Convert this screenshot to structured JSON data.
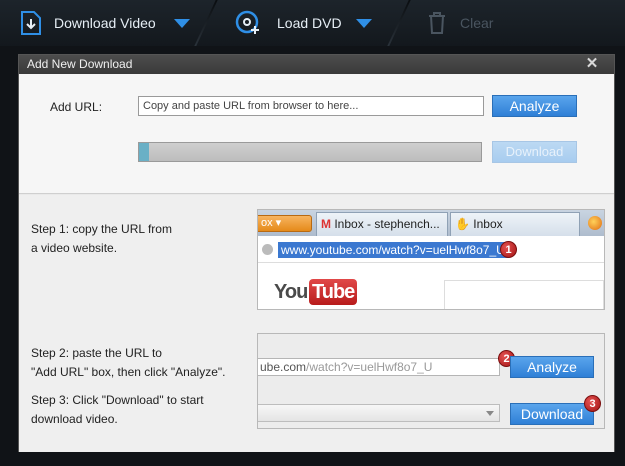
{
  "toolbar": {
    "download_video": "Download Video",
    "load_dvd": "Load DVD",
    "clear": "Clear"
  },
  "dialog": {
    "title": "Add New Download",
    "add_url_label": "Add URL:",
    "url_placeholder": "Copy and paste URL from browser to here...",
    "analyze_button": "Analyze",
    "download_button": "Download",
    "progress": 0.01
  },
  "steps": {
    "step1": [
      "Step 1: copy the URL from",
      "a video website."
    ],
    "step2": [
      "Step 2: paste the URL to",
      "\"Add URL\" box, then click \"Analyze\"."
    ],
    "step3": [
      "Step 3: Click \"Download\" to start",
      "download video."
    ]
  },
  "illustration": {
    "orange_tab": "ox",
    "tab_inbox_1": "Inbox - stephench...",
    "tab_inbox_2": "Inbox",
    "address_url": "www.youtube.com/watch?v=uelHwf8o7_U",
    "youtube_you": "You",
    "youtube_tube": "Tube",
    "pasted_url_dark": "ube.com",
    "pasted_url_light": "/watch?v=uelHwf8o7_U",
    "analyze_button": "Analyze",
    "download_button": "Download",
    "badge1": "1",
    "badge2": "2",
    "badge3": "3"
  },
  "colors": {
    "accent": "#2f7fd6",
    "badge": "#c62828",
    "toolbar_bg": "#1a2026"
  }
}
